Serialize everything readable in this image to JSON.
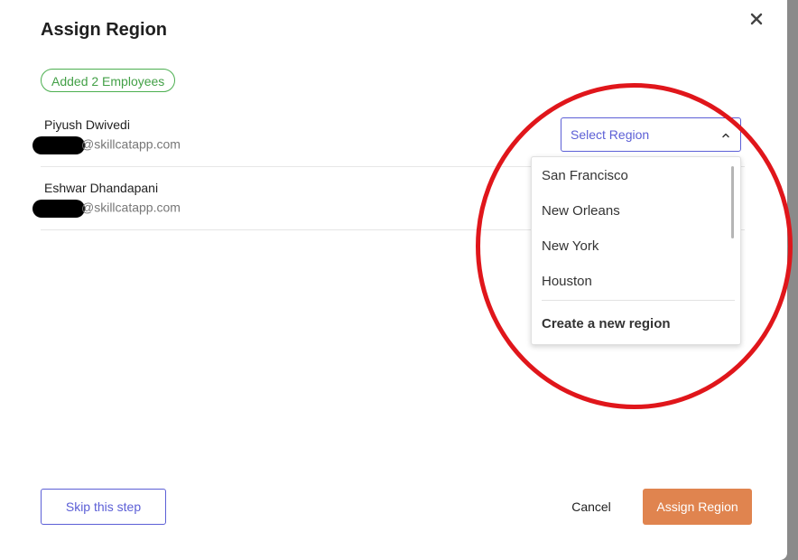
{
  "modal": {
    "title": "Assign Region",
    "badge": "Added 2 Employees"
  },
  "employees": [
    {
      "name": "Piyush Dwivedi",
      "email_domain": "@skillcatapp.com"
    },
    {
      "name": "Eshwar Dhandapani",
      "email_domain": "@skillcatapp.com"
    }
  ],
  "region_select": {
    "placeholder": "Select Region",
    "options": [
      "San Francisco",
      "New Orleans",
      "New York",
      "Houston"
    ],
    "create_label": "Create a new region"
  },
  "footer": {
    "skip_label": "Skip this step",
    "cancel_label": "Cancel",
    "assign_label": "Assign Region"
  },
  "colors": {
    "accent": "#5c5fd6",
    "success": "#43a047",
    "primary_button": "#e0844f",
    "annotation": "#e0161b"
  },
  "icons": {
    "close": "close-icon",
    "select_chevron": "chevron-up-icon"
  }
}
